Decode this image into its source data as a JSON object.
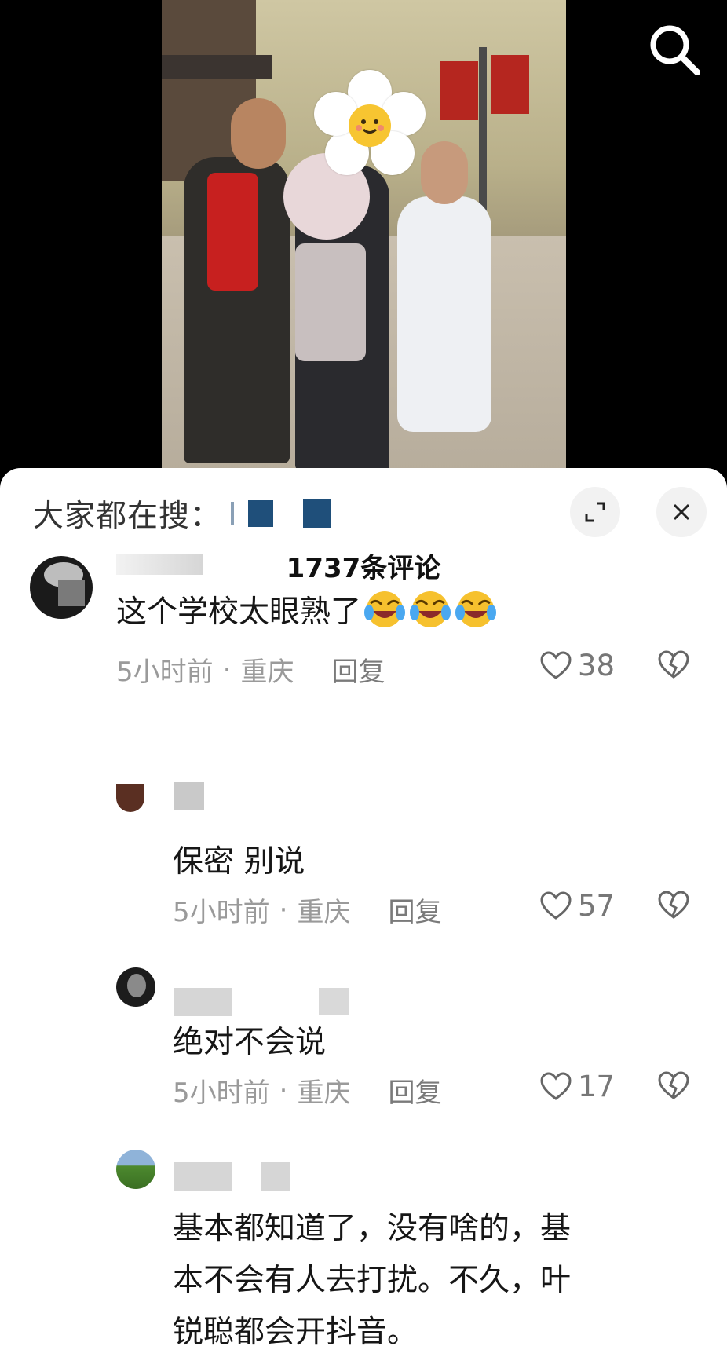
{
  "search_bar": {
    "label": "大家都在搜："
  },
  "comments_header": {
    "count_text": "1737条评论"
  },
  "comments": [
    {
      "text": "这个学校太眼熟了",
      "emoji_count": 3,
      "time": "5小时前",
      "location": "重庆",
      "reply_label": "回复",
      "likes": "38"
    },
    {
      "text": "保密 别说",
      "time": "5小时前",
      "location": "重庆",
      "reply_label": "回复",
      "likes": "57"
    },
    {
      "text": "绝对不会说",
      "time": "5小时前",
      "location": "重庆",
      "reply_label": "回复",
      "likes": "17"
    },
    {
      "text_lines": [
        "基本都知道了，没有啥的，基",
        "本不会有人去打扰。不久，叶",
        "锐聪都会开抖音。"
      ]
    }
  ],
  "meta_separator": "·",
  "icons": {
    "search": "search-icon",
    "expand": "expand-icon",
    "close": "close-icon",
    "like": "heart-icon",
    "dislike": "broken-heart-icon"
  },
  "colors": {
    "sheet_bg": "#ffffff",
    "muted_text": "#9a9a9a",
    "redaction_blue": "#1f4f7a"
  }
}
